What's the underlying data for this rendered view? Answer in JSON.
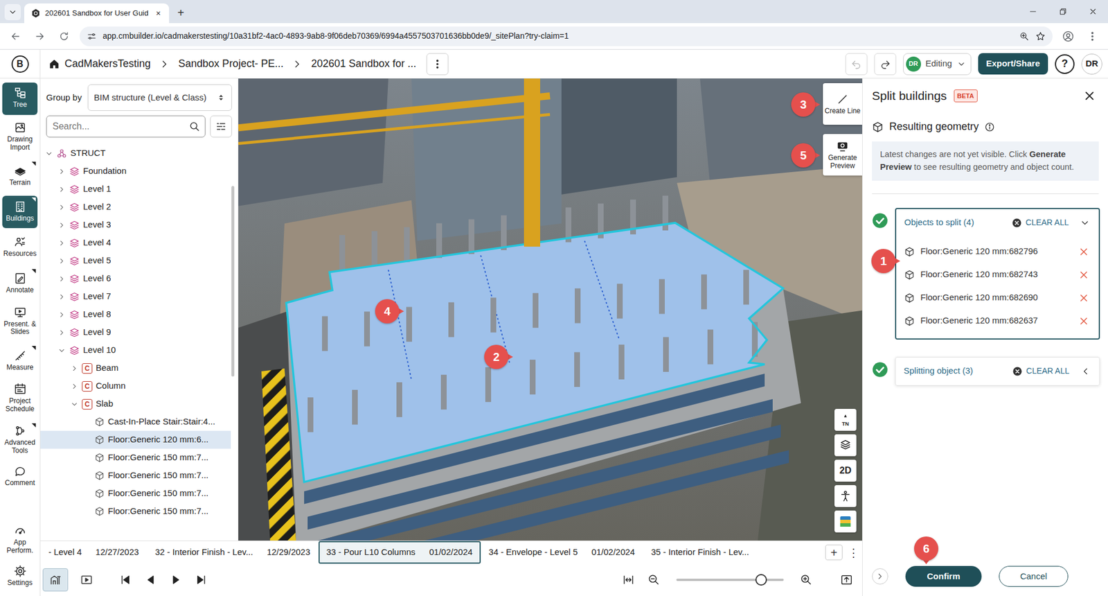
{
  "browser": {
    "tab": {
      "title": "202601 Sandbox for User Guid",
      "close": "×"
    },
    "new_tab": "+",
    "url": "app.cmbuilder.io/cadmakerstesting/10a31bf2-4ac0-4893-9ab8-9f06deb70369/6994a4557503701636bb0de9/_sitePlan?try-claim=1"
  },
  "header": {
    "logo": "B",
    "breadcrumbs": [
      "CadMakersTesting",
      "Sandbox Project- PE...",
      "202601 Sandbox for ..."
    ],
    "mode": {
      "avatar": "DR",
      "label": "Editing"
    },
    "export": "Export/Share",
    "help": "?",
    "user": "DR"
  },
  "rail": {
    "items": [
      {
        "label": "Tree",
        "selected": true,
        "submenu": false
      },
      {
        "label": "Drawing Import",
        "selected": false,
        "submenu": false
      },
      {
        "label": "Terrain",
        "selected": false,
        "submenu": true
      },
      {
        "label": "Buildings",
        "selected": true,
        "submenu": true
      },
      {
        "label": "Resources",
        "selected": false,
        "submenu": false
      },
      {
        "label": "Annotate",
        "selected": false,
        "submenu": true
      },
      {
        "label": "Present. & Slides",
        "selected": false,
        "submenu": false
      },
      {
        "label": "Measure",
        "selected": false,
        "submenu": true
      },
      {
        "label": "Project Schedule",
        "selected": false,
        "submenu": false
      },
      {
        "label": "Advanced Tools",
        "selected": false,
        "submenu": true
      },
      {
        "label": "Comment",
        "selected": false,
        "submenu": false
      }
    ],
    "bottom": [
      {
        "label": "App Perform."
      },
      {
        "label": "Settings"
      }
    ]
  },
  "tree": {
    "group_by_label": "Group by",
    "group_by_value": "BIM structure (Level & Class)",
    "search_placeholder": "Search...",
    "nodes": [
      {
        "label": "STRUCT",
        "depth": 0,
        "kind": "group",
        "expanded": true,
        "selected": false
      },
      {
        "label": "Foundation",
        "depth": 1,
        "kind": "level",
        "expanded": false,
        "selected": false
      },
      {
        "label": "Level 1",
        "depth": 1,
        "kind": "level",
        "expanded": false,
        "selected": false
      },
      {
        "label": "Level 2",
        "depth": 1,
        "kind": "level",
        "expanded": false,
        "selected": false
      },
      {
        "label": "Level 3",
        "depth": 1,
        "kind": "level",
        "expanded": false,
        "selected": false
      },
      {
        "label": "Level 4",
        "depth": 1,
        "kind": "level",
        "expanded": false,
        "selected": false
      },
      {
        "label": "Level 5",
        "depth": 1,
        "kind": "level",
        "expanded": false,
        "selected": false
      },
      {
        "label": "Level 6",
        "depth": 1,
        "kind": "level",
        "expanded": false,
        "selected": false
      },
      {
        "label": "Level 7",
        "depth": 1,
        "kind": "level",
        "expanded": false,
        "selected": false
      },
      {
        "label": "Level 8",
        "depth": 1,
        "kind": "level",
        "expanded": false,
        "selected": false
      },
      {
        "label": "Level 9",
        "depth": 1,
        "kind": "level",
        "expanded": false,
        "selected": false
      },
      {
        "label": "Level 10",
        "depth": 1,
        "kind": "level",
        "expanded": true,
        "selected": false
      },
      {
        "label": "Beam",
        "depth": 2,
        "kind": "class",
        "badge": "C",
        "expanded": false,
        "selected": false
      },
      {
        "label": "Column",
        "depth": 2,
        "kind": "class",
        "badge": "C",
        "expanded": false,
        "selected": false
      },
      {
        "label": "Slab",
        "depth": 2,
        "kind": "class",
        "badge": "C",
        "expanded": true,
        "selected": false
      },
      {
        "label": "Cast-In-Place Stair:Stair:4...",
        "depth": 3,
        "kind": "object",
        "selected": false
      },
      {
        "label": "Floor:Generic 120 mm:6...",
        "depth": 3,
        "kind": "object",
        "selected": true
      },
      {
        "label": "Floor:Generic 150 mm:7...",
        "depth": 3,
        "kind": "object",
        "selected": false
      },
      {
        "label": "Floor:Generic 150 mm:7...",
        "depth": 3,
        "kind": "object",
        "selected": false
      },
      {
        "label": "Floor:Generic 150 mm:7...",
        "depth": 3,
        "kind": "object",
        "selected": false
      },
      {
        "label": "Floor:Generic 150 mm:7...",
        "depth": 3,
        "kind": "object",
        "selected": false
      }
    ]
  },
  "viewport": {
    "tools": [
      {
        "label": "Create Line"
      },
      {
        "label": "Generate Preview"
      }
    ],
    "nav": [
      {
        "kind": "compass",
        "label": "TN"
      },
      {
        "kind": "layers"
      },
      {
        "kind": "text",
        "label": "2D"
      },
      {
        "kind": "person"
      },
      {
        "kind": "palette"
      }
    ]
  },
  "callouts": [
    {
      "number": "1"
    },
    {
      "number": "2"
    },
    {
      "number": "3"
    },
    {
      "number": "4"
    },
    {
      "number": "5"
    },
    {
      "number": "6"
    }
  ],
  "panel": {
    "title": "Split buildings",
    "badge": "BETA",
    "section_title": "Resulting geometry",
    "notice": [
      {
        "text": "Latest changes are not yet visible. Click ",
        "bold": false
      },
      {
        "text": "Generate Preview",
        "bold": true
      },
      {
        "text": " to see resulting geometry and object count.",
        "bold": false
      }
    ],
    "groups": [
      {
        "title": "Objects to split (4)",
        "clear": "CLEAR ALL",
        "done": true,
        "expanded": true,
        "items": [
          "Floor:Generic 120 mm:682796",
          "Floor:Generic 120 mm:682743",
          "Floor:Generic 120 mm:682690",
          "Floor:Generic 120 mm:682637"
        ]
      },
      {
        "title": "Splitting object (3)",
        "clear": "CLEAR ALL",
        "done": true,
        "expanded": false,
        "items": []
      }
    ],
    "confirm": "Confirm",
    "cancel": "Cancel"
  },
  "timeline": {
    "items": [
      {
        "title": "- Level 4",
        "date": "12/27/2023",
        "selected": false
      },
      {
        "title": "32 - Interior Finish - Lev...",
        "date": "12/29/2023",
        "selected": false
      },
      {
        "title": "33 - Pour L10 Columns",
        "date": "01/02/2024",
        "selected": true
      },
      {
        "title": "34 - Envelope - Level 5",
        "date": "01/02/2024",
        "selected": false
      },
      {
        "title": "35 - Interior Finish - Lev...",
        "selected": false
      }
    ],
    "add": "+",
    "menu": "⋮"
  },
  "controls": {
    "views": [
      {
        "selected": true
      },
      {
        "selected": false
      }
    ],
    "zoom": {
      "level": 0.79
    }
  }
}
